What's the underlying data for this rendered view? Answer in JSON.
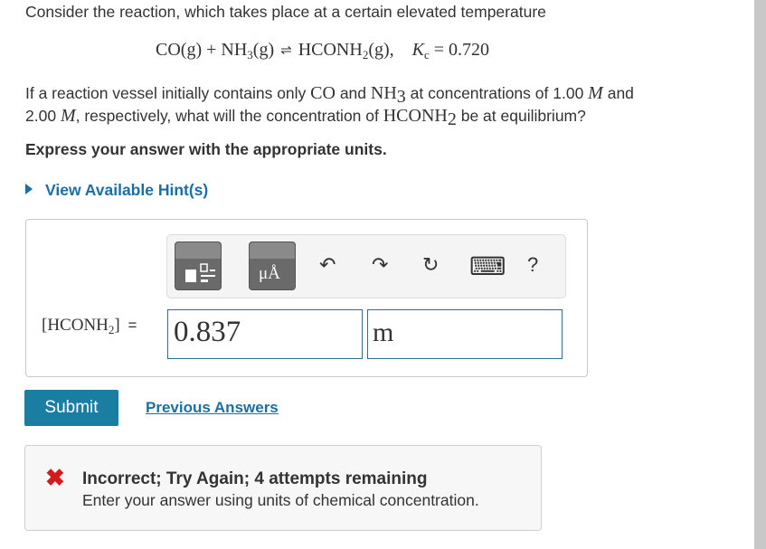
{
  "intro": "Consider the reaction, which takes place at a certain elevated temperature",
  "equation": {
    "left_part": "CO(g) + NH",
    "left_sub": "3",
    "left_end": "(g)",
    "right_part": "HCONH",
    "right_sub": "2",
    "right_end": "(g),",
    "k_label": "K",
    "k_sub": "c",
    "k_value": "= 0.720"
  },
  "question": {
    "line1_a": "If a reaction vessel initially contains only ",
    "line1_co": "CO",
    "line1_b": " and ",
    "line1_nh": "NH",
    "line1_nh_sub": "3",
    "line1_c": " at concentrations of 1.00 ",
    "line1_M": "M",
    "line1_d": " and",
    "line2_a": "2.00 ",
    "line2_M": "M",
    "line2_b": ", respectively, what will the concentration of ",
    "line2_hc": "HCONH",
    "line2_hc_sub": "2",
    "line2_c": " be at equilibrium?"
  },
  "instruction": "Express your answer with the appropriate units.",
  "hint_link": "View Available Hint(s)",
  "answer": {
    "label_open": "[HCONH",
    "label_sub": "2",
    "label_close": "]",
    "equals": "=",
    "value": "0.837",
    "unit": "m"
  },
  "toolbar": {
    "units_button_label": "μÅ",
    "undo_icon": "↶",
    "redo_icon": "↷",
    "reset_icon": "↻",
    "keyboard_icon": "⌨",
    "help_icon": "?"
  },
  "buttons": {
    "submit": "Submit",
    "previous_answers": "Previous Answers"
  },
  "feedback": {
    "icon": "✖",
    "title": "Incorrect; Try Again; 4 attempts remaining",
    "message": "Enter your answer using units of chemical concentration."
  },
  "colors": {
    "link": "#1a70a6",
    "submit_bg": "#1a7ea2",
    "error": "#d41a1a",
    "input_border": "#2b6d8c"
  }
}
